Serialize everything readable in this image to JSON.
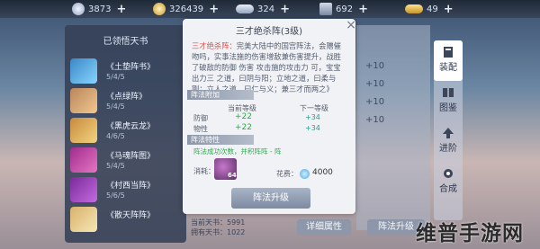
{
  "resources": [
    {
      "name": "silver",
      "value": "3873",
      "icon": "silver-coin-icon"
    },
    {
      "name": "gold",
      "value": "326439",
      "icon": "gold-coin-icon"
    },
    {
      "name": "ingot",
      "value": "324",
      "icon": "silver-ingot-icon"
    },
    {
      "name": "currency4",
      "value": "692",
      "icon": "gem-icon"
    },
    {
      "name": "currency5",
      "value": "49",
      "icon": "gold-ingot-icon"
    }
  ],
  "left_panel": {
    "title": "已领悟天书",
    "books": [
      {
        "name": "《土垫阵书》",
        "meta": "5/4/5"
      },
      {
        "name": "《点绿阵》",
        "meta": "5/4/5"
      },
      {
        "name": "《黑虎云龙》",
        "meta": "4/6/5"
      },
      {
        "name": "《马魂阵图》",
        "meta": "5/4/5"
      },
      {
        "name": "《村西当阵》",
        "meta": "5/6/5"
      },
      {
        "name": "《散天阵阵》",
        "meta": ""
      }
    ]
  },
  "popup": {
    "title": "三才绝杀阵(3级)",
    "desc_highlight": "三才绝杀阵：",
    "desc_body": "完美大陆中的国宫阵法，会赠催吻吗，实事法施的伤害增敌兼伤害提升，战胜了破敌的防御 伤害 攻击施的攻击力 可，宝宝出力三 之道，曰阴与阳；立地之道，曰柔与刚；立人之道，曰仁与义；兼三才而两之》",
    "section1": "阵法附加",
    "col_current": "当前等级",
    "col_next": "下一等级",
    "stats": [
      {
        "label": "防御",
        "current": "+22",
        "next": "+34"
      },
      {
        "label": "物性",
        "current": "+22",
        "next": "+34"
      }
    ],
    "section2": "阵法特性",
    "trait": "阵法成功次数，并积阵阵 - 阵",
    "consume_label": "消耗：",
    "mat_count": "64",
    "cost_label": "花费：",
    "cost_value": "4000",
    "upgrade_label": "阵法升级"
  },
  "right_panel": {
    "values": [
      "+10",
      "+10",
      "+10",
      "+10"
    ]
  },
  "side_nav": [
    {
      "label": "装配",
      "icon": "book-icon",
      "active": true
    },
    {
      "label": "图鉴",
      "icon": "catalog-icon",
      "active": false
    },
    {
      "label": "进阶",
      "icon": "advance-icon",
      "active": false
    },
    {
      "label": "合成",
      "icon": "compose-icon",
      "active": false
    }
  ],
  "bottom": {
    "pts1": "当前天书：5991",
    "pts2": "拥有天书：1022",
    "detail_btn": "详细属性",
    "upgrade_btn": "阵法升级"
  },
  "watermark": "维普手游网"
}
